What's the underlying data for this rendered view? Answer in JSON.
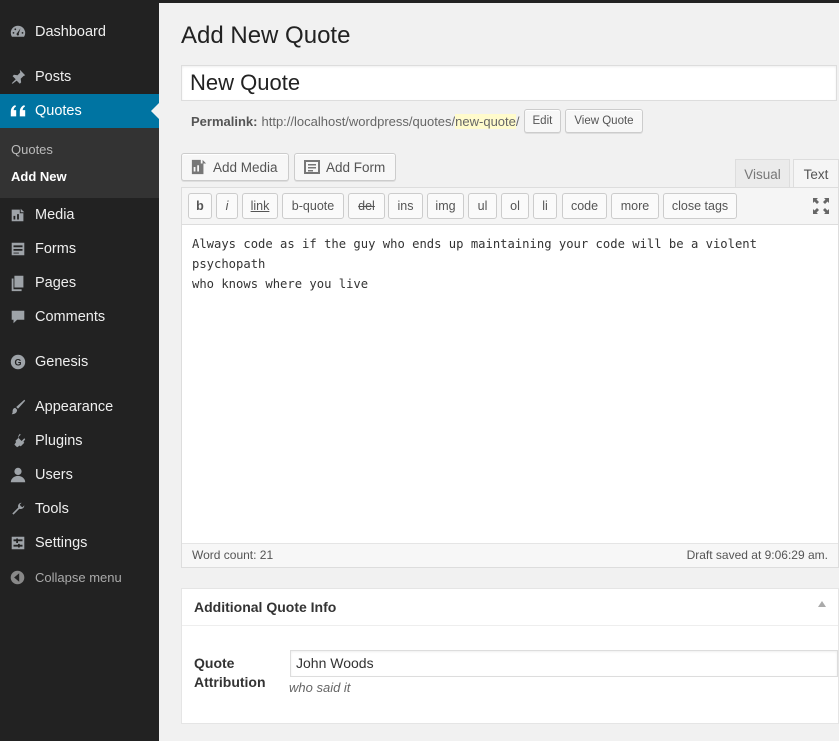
{
  "sidebar": {
    "items": [
      {
        "label": "Dashboard",
        "icon": "dashboard-icon"
      },
      {
        "label": "Posts",
        "icon": "pin-icon"
      },
      {
        "label": "Quotes",
        "icon": "quote-icon"
      },
      {
        "label": "Media",
        "icon": "media-icon"
      },
      {
        "label": "Forms",
        "icon": "forms-icon"
      },
      {
        "label": "Pages",
        "icon": "pages-icon"
      },
      {
        "label": "Comments",
        "icon": "comment-icon"
      },
      {
        "label": "Genesis",
        "icon": "genesis-icon"
      },
      {
        "label": "Appearance",
        "icon": "brush-icon"
      },
      {
        "label": "Plugins",
        "icon": "plugin-icon"
      },
      {
        "label": "Users",
        "icon": "user-icon"
      },
      {
        "label": "Tools",
        "icon": "wrench-icon"
      },
      {
        "label": "Settings",
        "icon": "settings-icon"
      }
    ],
    "submenu": [
      "Quotes",
      "Add New"
    ],
    "collapse_label": "Collapse menu",
    "accent_color": "#0074a2"
  },
  "page": {
    "title": "Add New Quote",
    "post_title": "New Quote"
  },
  "permalink": {
    "label": "Permalink:",
    "base": "http://localhost/wordpress/quotes/",
    "slug": "new-quote",
    "trailing": "/",
    "edit_label": "Edit",
    "view_label": "View Quote"
  },
  "media_buttons": {
    "add_media": "Add Media",
    "add_form": "Add Form"
  },
  "editor": {
    "tab_visual": "Visual",
    "tab_text": "Text",
    "quicktags": [
      "b",
      "i",
      "link",
      "b-quote",
      "del",
      "ins",
      "img",
      "ul",
      "ol",
      "li",
      "code",
      "more",
      "close tags"
    ],
    "content": "Always code as if the guy who ends up maintaining your code will be a violent psychopath\nwho knows where you live",
    "word_count": "Word count: 21",
    "draft_saved": "Draft saved at 9:06:29 am."
  },
  "metabox": {
    "title": "Additional Quote Info",
    "attribution_label": "Quote Attribution",
    "attribution_value": "John Woods",
    "attribution_description": "who said it"
  }
}
